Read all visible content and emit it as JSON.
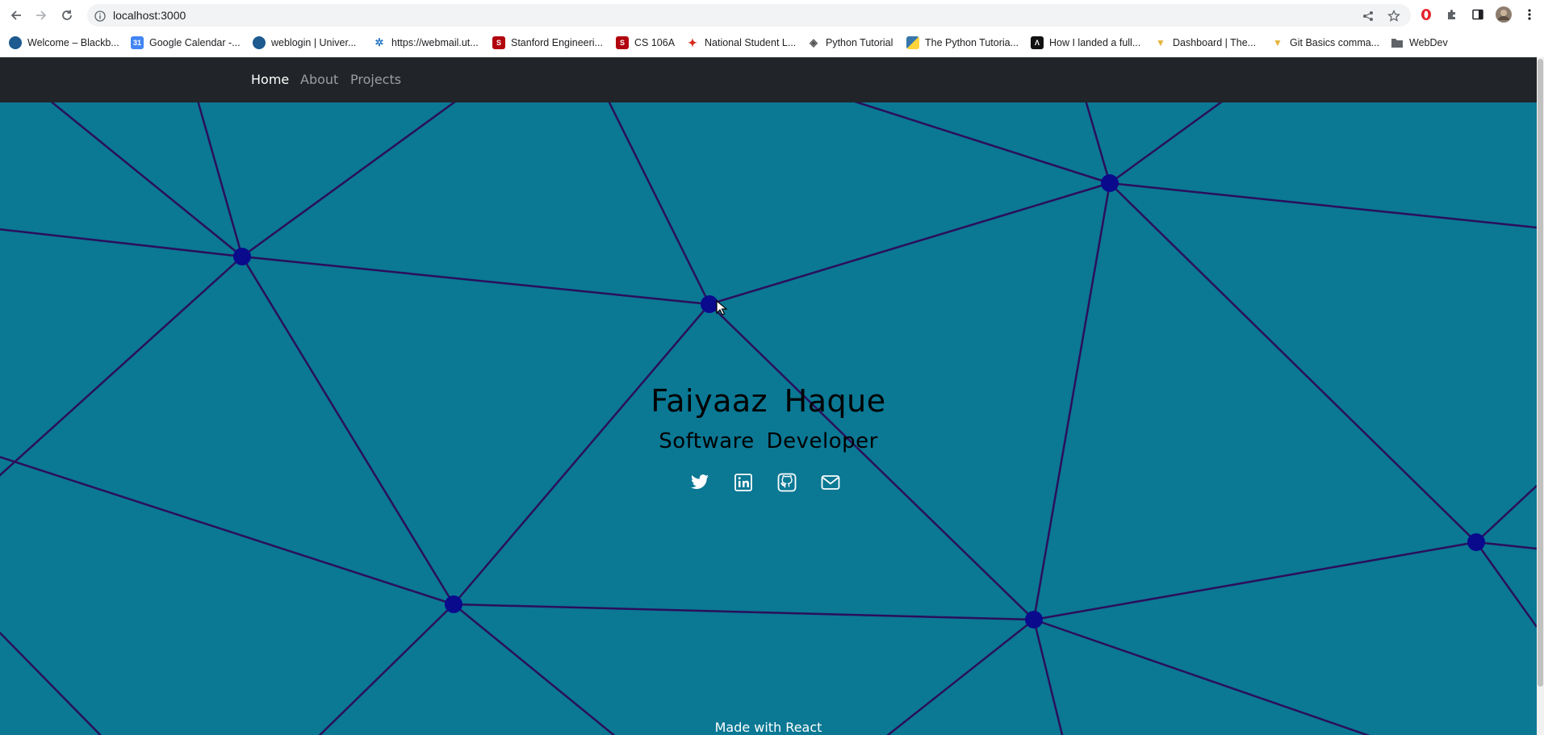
{
  "browser": {
    "url": "localhost:3000",
    "bookmarks": [
      {
        "label": "Welcome – Blackb...",
        "icon": "blackboard-icon",
        "color": "#1c5a8f"
      },
      {
        "label": "Google Calendar -...",
        "icon": "calendar-icon",
        "color": "#4285f4"
      },
      {
        "label": "weblogin | Univer...",
        "icon": "uoft-icon",
        "color": "#1c5a8f"
      },
      {
        "label": "https://webmail.ut...",
        "icon": "webmail-icon",
        "color": "#2d7ac4"
      },
      {
        "label": "Stanford Engineeri...",
        "icon": "stanford-icon",
        "color": "#b1040e"
      },
      {
        "label": "CS 106A",
        "icon": "stanford-icon",
        "color": "#b1040e"
      },
      {
        "label": "National Student L...",
        "icon": "maple-leaf-icon",
        "color": "#d52b1e"
      },
      {
        "label": "Python Tutorial",
        "icon": "diamond-icon",
        "color": "#555555"
      },
      {
        "label": "The Python Tutoria...",
        "icon": "python-icon",
        "color": "#3776ab"
      },
      {
        "label": "How I landed a full...",
        "icon": "site-icon",
        "color": "#111111"
      },
      {
        "label": "Dashboard | The...",
        "icon": "odin-icon",
        "color": "#e5b53a"
      },
      {
        "label": "Git Basics comma...",
        "icon": "odin-icon",
        "color": "#e5b53a"
      },
      {
        "label": "WebDev",
        "icon": "folder-icon",
        "color": "#5f6368"
      }
    ]
  },
  "nav": {
    "links": [
      {
        "label": "Home",
        "active": true
      },
      {
        "label": "About",
        "active": false
      },
      {
        "label": "Projects",
        "active": false
      }
    ]
  },
  "hero": {
    "name": "Faiyaaz Haque",
    "role": "Software Developer",
    "socials": [
      {
        "name": "twitter-icon"
      },
      {
        "name": "linkedin-icon"
      },
      {
        "name": "github-icon"
      },
      {
        "name": "email-icon"
      }
    ],
    "footer": "Made with React"
  },
  "colors": {
    "hero_bg": "#0b7894",
    "navbar_bg": "#212529",
    "node": "#0a0a8c",
    "line": "#2a0f5c"
  }
}
